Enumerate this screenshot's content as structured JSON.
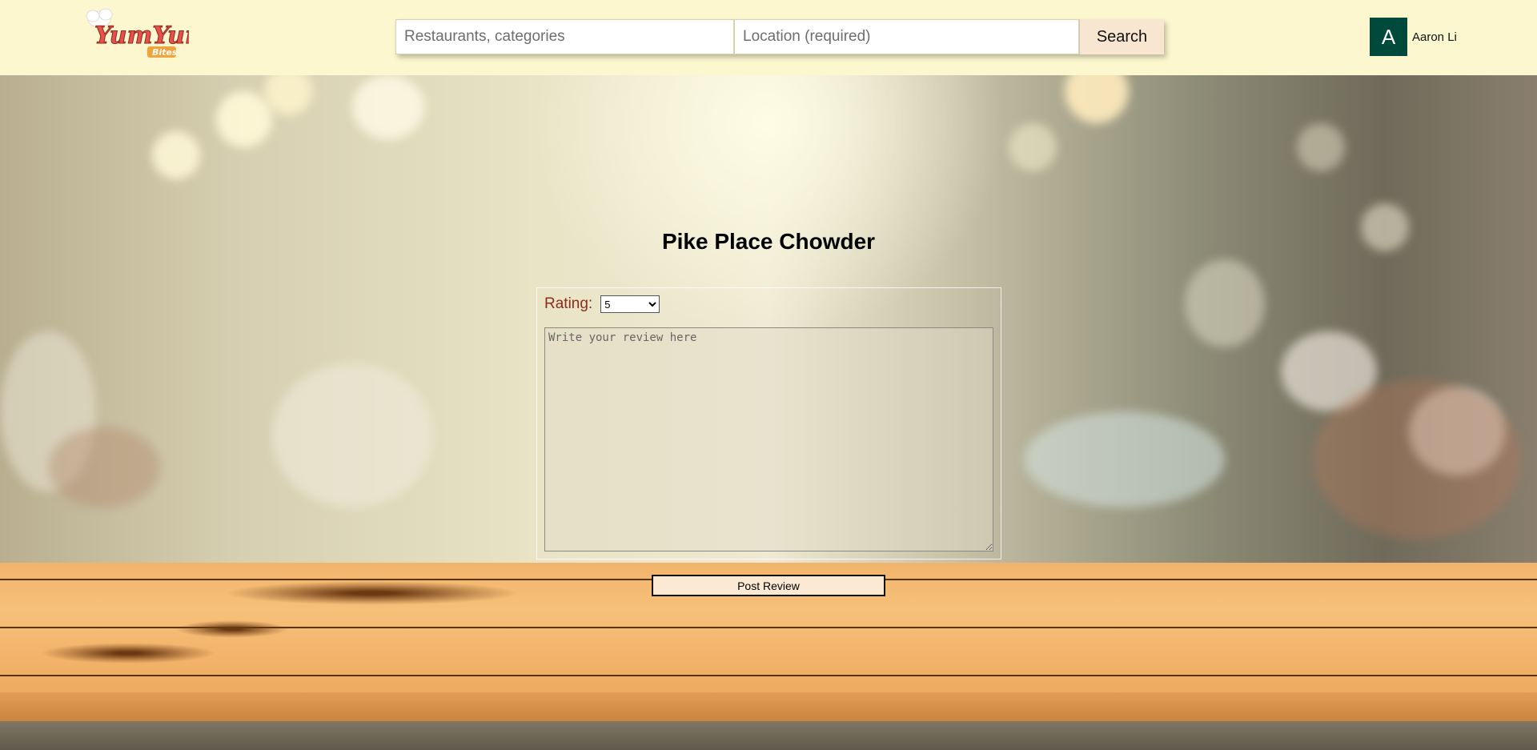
{
  "header": {
    "logo": {
      "main_text": "YumYum",
      "sub_text": "Bites"
    },
    "search": {
      "what_placeholder": "Restaurants, categories",
      "where_placeholder": "Location (required)",
      "button_label": "Search"
    },
    "user": {
      "avatar_initial": "A",
      "name": "Aaron Li",
      "avatar_color": "#004a3c"
    }
  },
  "review": {
    "restaurant_name": "Pike Place Chowder",
    "rating_label": "Rating:",
    "rating_value": "5",
    "rating_options": [
      "5"
    ],
    "text_placeholder": "Write your review here",
    "text_value": "",
    "post_button_label": "Post Review"
  },
  "colors": {
    "header_bg": "#fdf7cf",
    "search_button_bg": "#f8e6d0",
    "rating_label": "#8b2c1c",
    "post_button_bg": "#fbe9d4"
  }
}
